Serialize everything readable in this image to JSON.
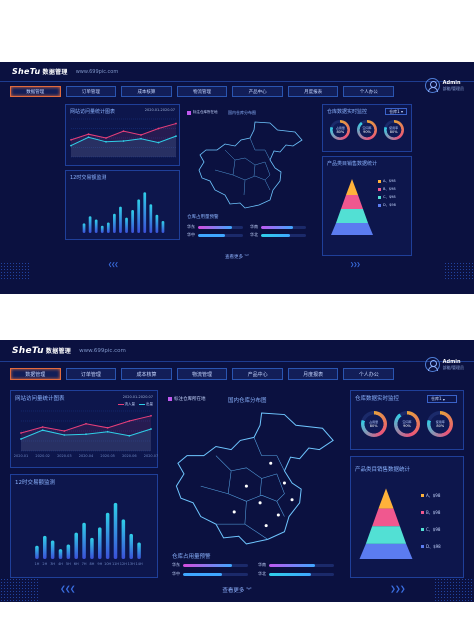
{
  "app": {
    "logo": "SheTu",
    "logo_sub": "数据管理",
    "site": "www.699pic.com"
  },
  "user": {
    "name": "Admin",
    "role": "部能/管理员"
  },
  "nav": {
    "tabs": [
      "数据管理",
      "订单管理",
      "成本核算",
      "物流管理",
      "产品中心",
      "月度报表",
      "个人办公"
    ]
  },
  "visits": {
    "title": "网站访问量统计图表",
    "date": "2020.01-2020.07",
    "legend_in": "流入量",
    "legend_out": "出量"
  },
  "trade": {
    "title": "12时交易额监测"
  },
  "map": {
    "marker_label": "标注仓库所在地",
    "title": "国内仓库分布图"
  },
  "warehouse": {
    "title": "仓库占用量预警",
    "items": [
      {
        "name": "华东",
        "value": 0.75,
        "color": "#d64bdc"
      },
      {
        "name": "华中",
        "value": 0.6,
        "color": "#3fa7ff"
      },
      {
        "name": "华南",
        "value": 0.7,
        "color": "#c158f0"
      },
      {
        "name": "华北",
        "value": 0.65,
        "color": "#2fd0e8"
      }
    ]
  },
  "realtime": {
    "title": "仓库数据实时监控",
    "select": "仓库1",
    "rings": [
      {
        "caption": "占用量",
        "value": "80%",
        "fraction": 0.8
      },
      {
        "caption": "空间率",
        "value": "90%",
        "fraction": 0.9
      },
      {
        "caption": "使用率",
        "value": "80%",
        "fraction": 0.8
      }
    ]
  },
  "products": {
    "title": "产品类目销售数据统计",
    "legend": [
      "A、$98",
      "B、$98",
      "C、$98",
      "D、$98"
    ]
  },
  "more": "查看更多",
  "colors": {
    "bg": "#0b1140",
    "accent": "#e26b3e",
    "line_a": "#e83f7a",
    "line_b": "#2fd0e8"
  },
  "chart_data": [
    {
      "type": "line",
      "title": "网站访问量统计图表",
      "x": [
        "2020.01",
        "2020.02",
        "2020.03",
        "2020.04",
        "2020.05",
        "2020.06",
        "2020.07"
      ],
      "series": [
        {
          "name": "流入量",
          "values": [
            45,
            60,
            50,
            68,
            58,
            75,
            88
          ]
        },
        {
          "name": "出量",
          "values": [
            30,
            52,
            40,
            42,
            48,
            38,
            55
          ]
        }
      ],
      "ylim": [
        0,
        100
      ]
    },
    {
      "type": "bar",
      "title": "12时交易额监测",
      "categories": [
        "1H",
        "2H",
        "3H",
        "4H",
        "5H",
        "6H",
        "7H",
        "8H",
        "9H",
        "10H",
        "11H",
        "12H",
        "13H",
        "14H"
      ],
      "values": [
        20,
        35,
        28,
        15,
        22,
        40,
        55,
        32,
        48,
        70,
        85,
        60,
        38,
        25
      ],
      "ylim": [
        0,
        100
      ]
    }
  ]
}
